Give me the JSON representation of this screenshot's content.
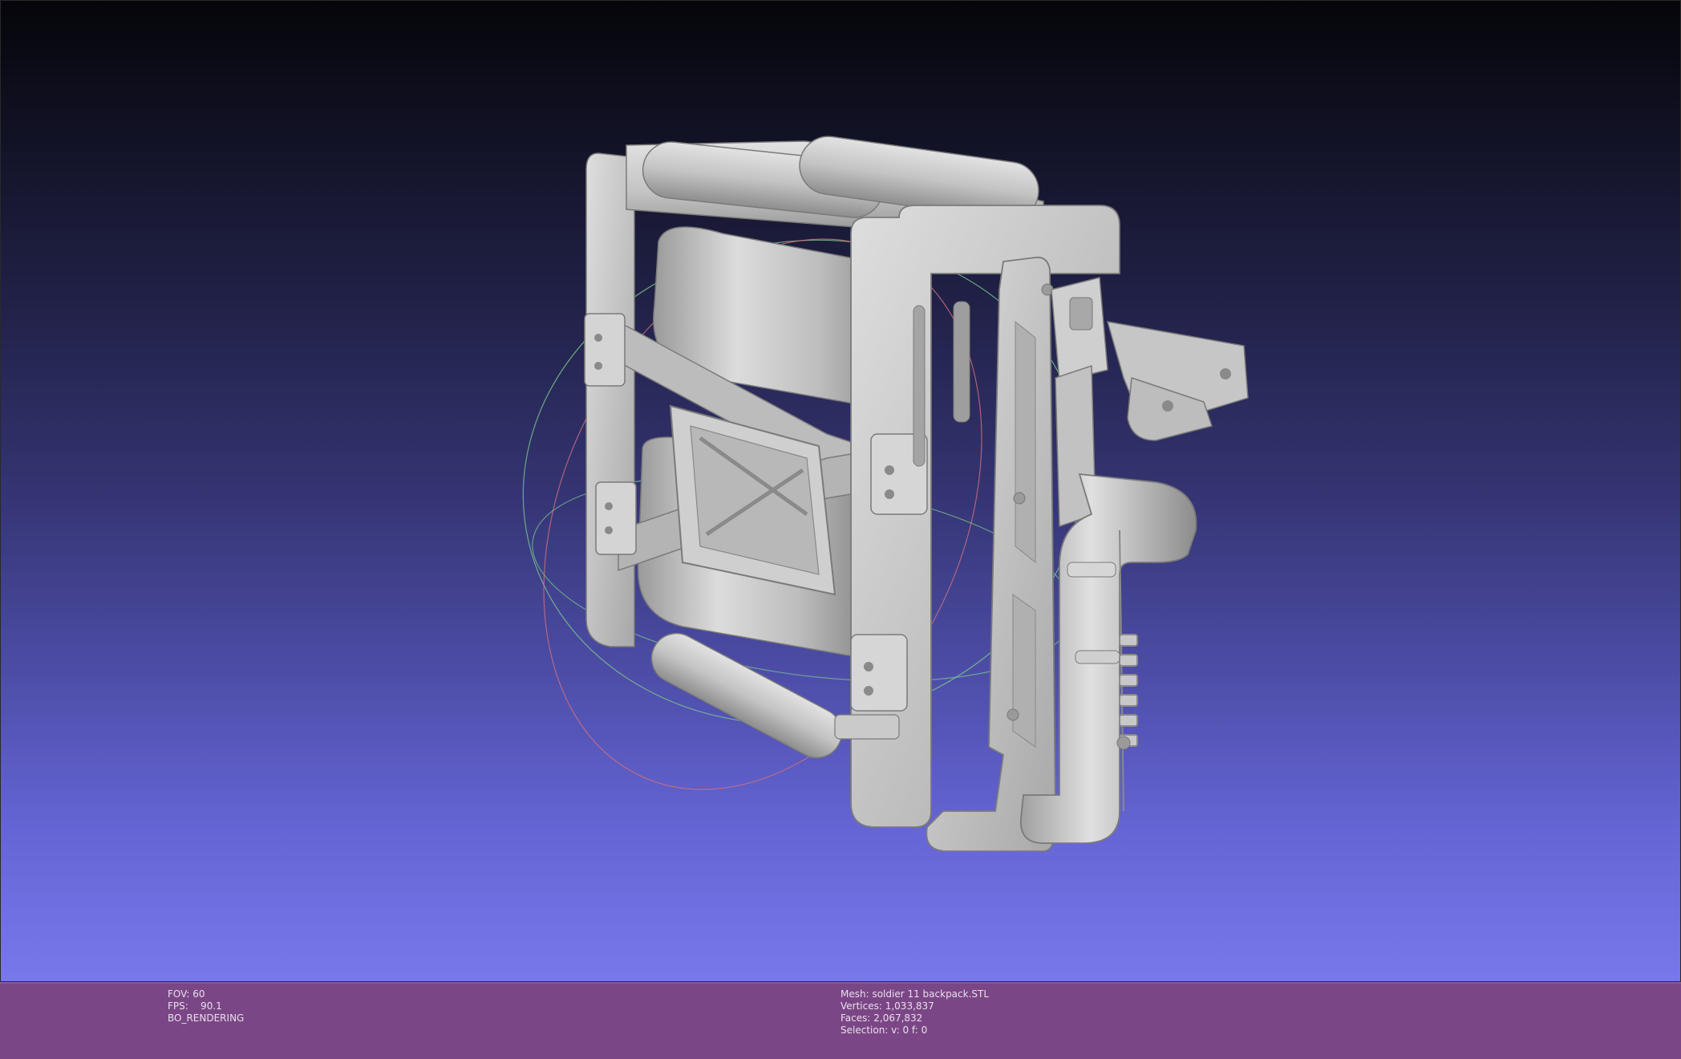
{
  "viewer": {
    "stats_left": {
      "fov": "FOV: 60",
      "fps": "FPS:    90.1",
      "mode": "BO_RENDERING"
    },
    "stats_right": {
      "mesh": "Mesh: soldier 11 backpack.STL",
      "vertices": "Vertices: 1,033,837",
      "faces": "Faces: 2,067,832",
      "selection": "Selection: v: 0 f: 0"
    }
  },
  "colors": {
    "background_top": "#05050a",
    "background_bottom": "#7878ec",
    "info_bar": "#7b4686",
    "model": "#c8c8c8",
    "trackball_red": "#d0707a",
    "trackball_green": "#7ac88a"
  }
}
